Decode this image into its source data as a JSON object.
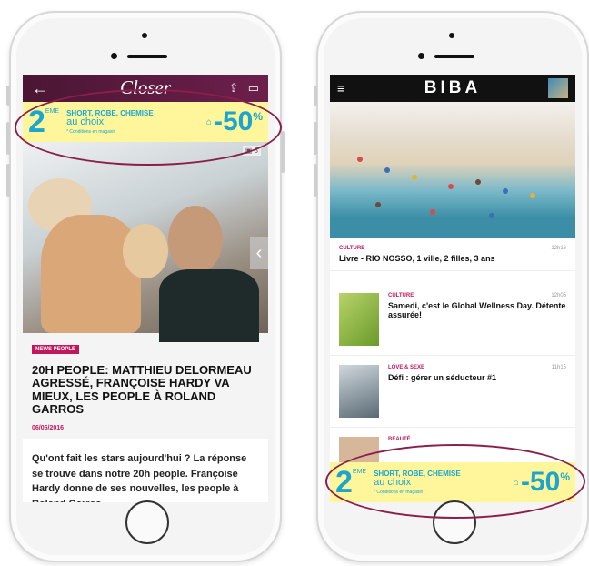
{
  "left_phone": {
    "app": {
      "logo": "Closer",
      "back_icon": "back-arrow-icon",
      "share_icon": "share-icon",
      "comments_icon": "comment-icon"
    },
    "ad": {
      "big_number": "2",
      "superscript": "EME",
      "line1": "SHORT, ROBE, CHEMISE",
      "line2": "au choix",
      "line3": "* Conditions en magasin",
      "discount": "-50",
      "percent": "%"
    },
    "photo_count": "5",
    "article": {
      "tag": "NEWS PEOPLE",
      "headline": "20H PEOPLE: MATTHIEU DELORMEAU AGRESSÉ, FRANÇOISE HARDY VA MIEUX, LES PEOPLE À ROLAND GARROS",
      "date": "06/06/2016",
      "lead": "Qu'ont fait les stars aujourd'hui ? La réponse se trouve dans notre 20h people. Françoise Hardy donne de ses nouvelles, les people à Roland Garros,"
    }
  },
  "right_phone": {
    "app": {
      "logo": "BIBA",
      "menu_icon": "hamburger-menu-icon"
    },
    "items": [
      {
        "category": "CULTURE",
        "time": "12h16",
        "title": "Livre - RIO NOSSO, 1 ville, 2 filles, 3 ans"
      },
      {
        "category": "CULTURE",
        "time": "12h05",
        "title": "Samedi, c'est le Global Wellness Day. Détente assurée!"
      },
      {
        "category": "LOVE & SEXE",
        "time": "11h15",
        "title": "Défi : gérer un séducteur #1"
      },
      {
        "category": "BEAUTÉ"
      }
    ],
    "ad": {
      "big_number": "2",
      "superscript": "EME",
      "line1": "SHORT, ROBE, CHEMISE",
      "line2": "au choix",
      "line3": "* Conditions en magasin",
      "discount": "-50",
      "percent": "%"
    }
  },
  "colors": {
    "closer_bar": "#5a1a3e",
    "ad_background": "#fff59a",
    "ad_text": "#1ca6cf",
    "accent": "#c2185b",
    "highlight": "#8a1f4a"
  }
}
